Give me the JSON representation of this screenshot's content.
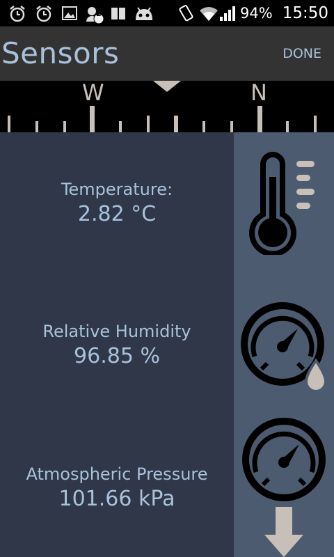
{
  "status_bar": {
    "battery": "94%",
    "time": "15:50",
    "notification_count": "2"
  },
  "app_bar": {
    "title": "Sensors",
    "done_label": "DONE"
  },
  "compass": {
    "labels": [
      "W",
      "N"
    ]
  },
  "sensors": [
    {
      "label": "Temperature:",
      "value": "2.82 °C",
      "icon": "thermometer-icon"
    },
    {
      "label": "Relative Humidity",
      "value": "96.85 %",
      "icon": "hygrometer-icon"
    },
    {
      "label": "Atmospheric Pressure",
      "value": "101.66 kPa",
      "icon": "barometer-icon"
    }
  ]
}
